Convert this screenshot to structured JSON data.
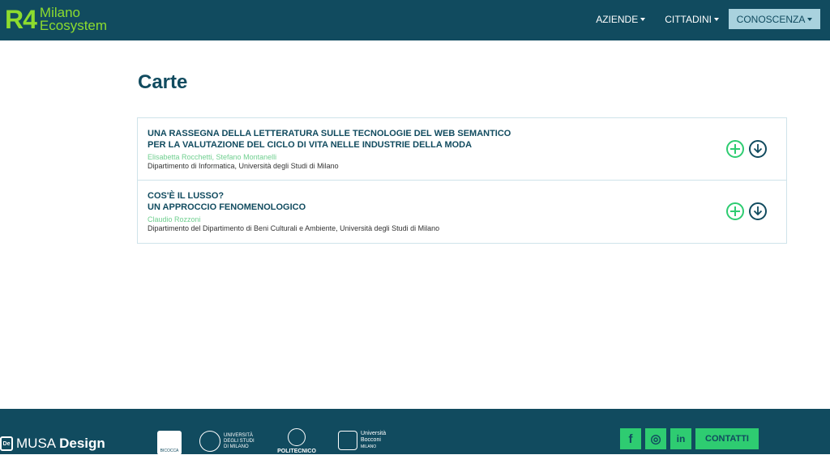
{
  "brand": {
    "mark": "R4",
    "line1": "Milano",
    "line2": "Ecosystem"
  },
  "nav": {
    "items": [
      {
        "label": "AZIENDE"
      },
      {
        "label": "CITTADINI"
      },
      {
        "label": "CONOSCENZA"
      }
    ]
  },
  "page": {
    "title": "Carte"
  },
  "papers": [
    {
      "title_line1": "UNA RASSEGNA DELLA LETTERATURA SULLE TECNOLOGIE DEL WEB SEMANTICO",
      "title_line2": "PER LA VALUTAZIONE DEL CICLO DI VITA NELLE INDUSTRIE DELLA MODA",
      "authors": "Elisabetta Rocchetti, Stefano Montanelli",
      "department": "Dipartimento di Informatica, Università degli Studi di Milano",
      "add_icon": "plus-circle-icon",
      "download_icon": "download-circle-icon"
    },
    {
      "title_line1": "COS'È IL LUSSO?",
      "title_line2": "UN APPROCCIO FENOMENOLOGICO",
      "authors": "Claudio Rozzoni",
      "department": "Dipartimento del Dipartimento di Beni Culturali e Ambiente, Università degli Studi di Milano",
      "add_icon": "plus-circle-icon",
      "download_icon": "download-circle-icon"
    }
  ],
  "footer": {
    "musa": {
      "badge": "De",
      "name": "MUSA",
      "suffix": "Design"
    },
    "bicocca_label": "BICOCCA",
    "unimi": [
      "UNIVERSITÀ",
      "DEGLI STUDI",
      "DI MILANO"
    ],
    "polimi": "POLITECNICO",
    "bocconi": [
      "Università",
      "Bocconi",
      "MILANO"
    ],
    "social": [
      {
        "icon": "facebook-icon",
        "glyph": "f"
      },
      {
        "icon": "instagram-icon",
        "glyph": "◎"
      },
      {
        "icon": "linkedin-icon",
        "glyph": "in"
      }
    ],
    "contact_label": "CONTATTI"
  },
  "colors": {
    "primary": "#114b5f",
    "accent": "#2ecc71",
    "brand_green": "#8ddc2e",
    "active_nav": "#a9d2de"
  }
}
